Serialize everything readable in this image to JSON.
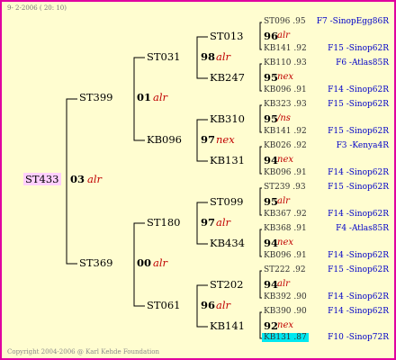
{
  "header": "9-  2-2006 ( 20: 10)",
  "footer": "Copyright 2004-2006 @ Karl Kehde Foundation",
  "root": {
    "name": "ST433",
    "num": "03",
    "type": "alr"
  },
  "gen2": [
    {
      "name": "ST399",
      "num": "01",
      "type": "alr"
    },
    {
      "name": "ST369",
      "num": "00",
      "type": "alr"
    }
  ],
  "gen3": [
    {
      "name": "ST031",
      "num": "98",
      "type": "alr"
    },
    {
      "name": "KB096",
      "num": "97",
      "type": "nex"
    },
    {
      "name": "ST180",
      "num": "97",
      "type": "alr"
    },
    {
      "name": "ST061",
      "num": "96",
      "type": "alr"
    }
  ],
  "gen4": [
    {
      "name": "ST013",
      "num": "96",
      "type": "alr"
    },
    {
      "name": "KB247",
      "num": "95",
      "type": "nex"
    },
    {
      "name": "KB310",
      "num": "95",
      "type": "/ns"
    },
    {
      "name": "KB131",
      "num": "94",
      "type": "nex"
    },
    {
      "name": "ST099",
      "num": "95",
      "type": "alr"
    },
    {
      "name": "KB434",
      "num": "94",
      "type": "nex"
    },
    {
      "name": "ST202",
      "num": "94",
      "type": "alr"
    },
    {
      "name": "KB141",
      "num": "92",
      "type": "nex"
    }
  ],
  "gen5": [
    {
      "name": "ST096",
      "year": ".95",
      "info": "F7 -SinopEgg86R"
    },
    {
      "name": "KB141",
      "year": ".92",
      "info": "F15 -Sinop62R"
    },
    {
      "name": "KB110",
      "year": ".93",
      "info": "F6 -Atlas85R"
    },
    {
      "name": "KB096",
      "year": ".91",
      "info": "F14 -Sinop62R"
    },
    {
      "name": "KB323",
      "year": ".93",
      "info": "F15 -Sinop62R"
    },
    {
      "name": "KB141",
      "year": ".92",
      "info": "F15 -Sinop62R"
    },
    {
      "name": "KB026",
      "year": ".92",
      "info": "F3 -Kenya4R"
    },
    {
      "name": "KB096",
      "year": ".91",
      "info": "F14 -Sinop62R"
    },
    {
      "name": "ST239",
      "year": ".93",
      "info": "F15 -Sinop62R"
    },
    {
      "name": "KB367",
      "year": ".92",
      "info": "F14 -Sinop62R"
    },
    {
      "name": "KB368",
      "year": ".91",
      "info": "F4 -Atlas85R"
    },
    {
      "name": "KB096",
      "year": ".91",
      "info": "F14 -Sinop62R"
    },
    {
      "name": "ST222",
      "year": ".92",
      "info": "F15 -Sinop62R"
    },
    {
      "name": "KB392",
      "year": ".90",
      "info": "F14 -Sinop62R"
    },
    {
      "name": "KB390",
      "year": ".90",
      "info": "F14 -Sinop62R"
    },
    {
      "name": "KB131",
      "year": ".87",
      "info": "F10 -Sinop72R"
    }
  ],
  "colors": {
    "border": "#e000a0",
    "background": "#fffdd0",
    "highlight": "#00e8f0",
    "root_highlight": "#ffd0ff",
    "type_text": "#c00000",
    "info_text": "#0000c8"
  }
}
